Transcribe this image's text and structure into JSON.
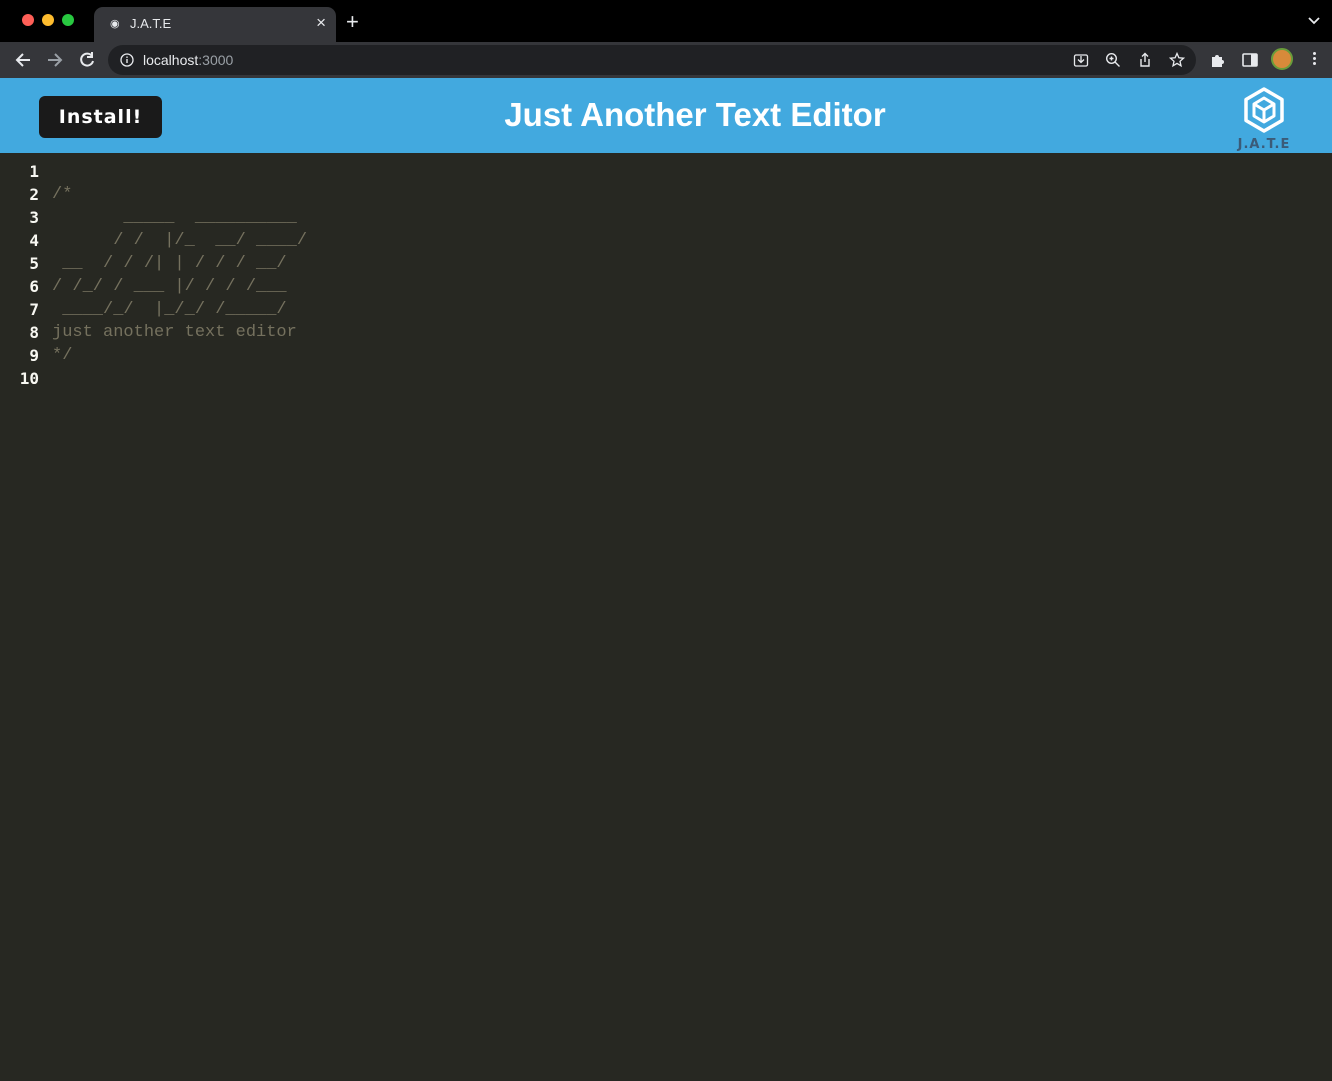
{
  "browser": {
    "tab": {
      "title": "J.A.T.E"
    },
    "address": {
      "host": "localhost",
      "port": ":3000"
    }
  },
  "app": {
    "install_label": "Install!",
    "title": "Just Another Text Editor",
    "logo_text": "J.A.T.E"
  },
  "editor": {
    "line_numbers": [
      "1",
      "2",
      "3",
      "4",
      "5",
      "6",
      "7",
      "8",
      "9",
      "10"
    ],
    "lines": [
      "",
      "/*",
      "       _____  __________",
      "      / /  |/_  __/ ____/",
      " __  / / /| | / / / __/",
      "/ /_/ / ___ |/ / / /___",
      " ____/_/  |_/_/ /_____/",
      "just another text editor",
      "*/",
      ""
    ],
    "colors": {
      "background": "#272822",
      "comment": "#75715e",
      "gutter_text": "#f8f8f2"
    }
  },
  "theme": {
    "header_bg": "#42a9df",
    "button_bg": "#1a1a1a"
  }
}
